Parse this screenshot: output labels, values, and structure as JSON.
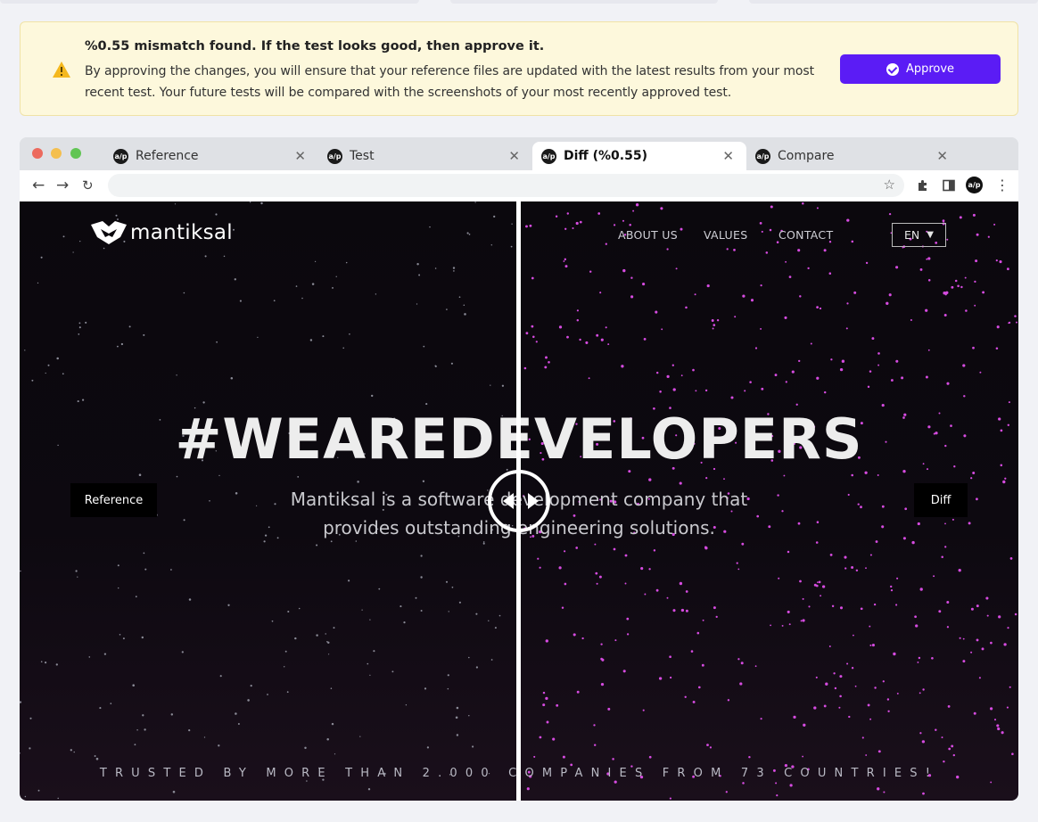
{
  "banner": {
    "title": "%0.55 mismatch found. If the test looks good, then approve it.",
    "body": "By approving the changes, you will ensure that your reference files are updated with the latest results from your most recent test. Your future tests will be compared with the screenshots of your most recently approved test.",
    "approve_label": "Approve",
    "warning_icon": "warning-triangle-icon",
    "accent_color": "#5b1cf5"
  },
  "tabs": [
    {
      "label": "Reference",
      "active": false
    },
    {
      "label": "Test",
      "active": false
    },
    {
      "label": "Diff (%0.55)",
      "active": true
    },
    {
      "label": "Compare",
      "active": false
    }
  ],
  "tab_favicon_text": "a/p",
  "toolbar": {
    "address": "",
    "icons": [
      "back-arrow-icon",
      "forward-arrow-icon",
      "reload-icon",
      "star-icon",
      "extensions-icon",
      "side-panel-icon",
      "profile-icon",
      "menu-icon"
    ]
  },
  "site": {
    "logo_text": "mantiksal",
    "nav": [
      "ABOUT US",
      "VALUES",
      "CONTACT"
    ],
    "language": "EN",
    "headline": "#WEAREDEVELOPERS",
    "subheadline": "Mantiksal is a software development company that provides outstanding engineering solutions.",
    "trusted": "TRUSTED BY MORE THAN 2.000 COMPANIES FROM 73 COUNTRIES!"
  },
  "compare": {
    "left_label": "Reference",
    "right_label": "Diff",
    "diff_color": "#d64be0"
  }
}
